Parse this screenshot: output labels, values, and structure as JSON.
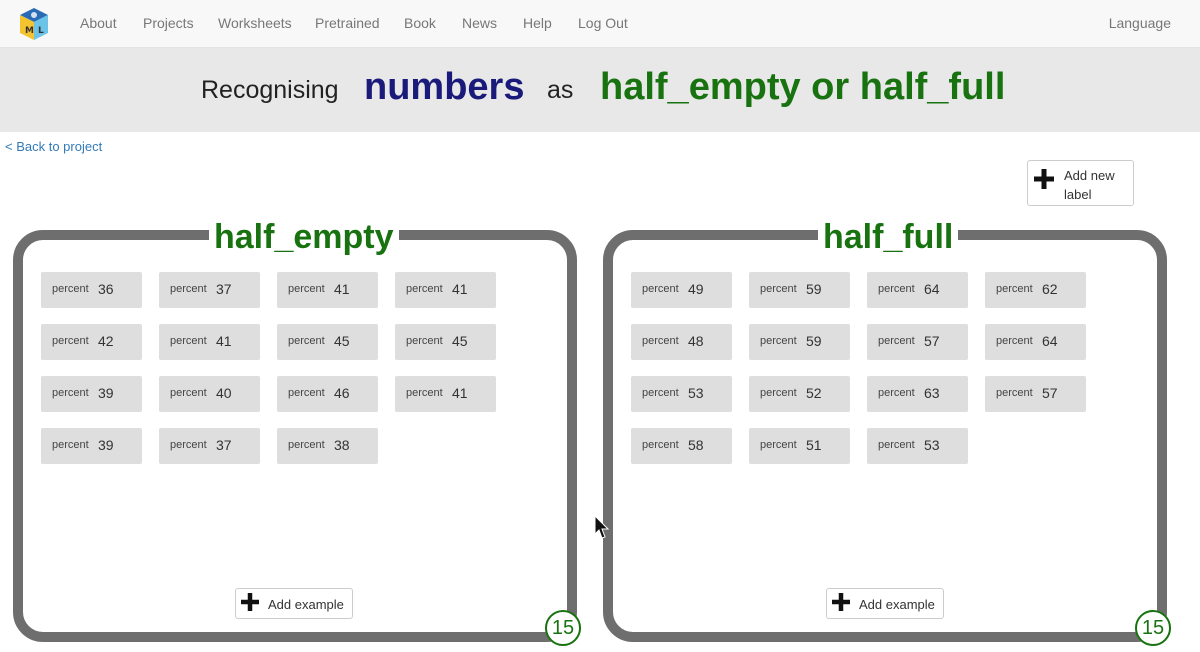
{
  "nav": {
    "items": [
      "About",
      "Projects",
      "Worksheets",
      "Pretrained",
      "Book",
      "News",
      "Help",
      "Log Out"
    ],
    "language": "Language"
  },
  "header": {
    "word_recognising": "Recognising",
    "project_name": "numbers",
    "word_as": "as",
    "labels_text": "half_empty or half_full"
  },
  "back_link": "< Back to project",
  "add_label_button": {
    "line1": "Add new",
    "line2": "label"
  },
  "buckets": [
    {
      "label": "half_empty",
      "examples": [
        {
          "key": "percent",
          "value": "36"
        },
        {
          "key": "percent",
          "value": "37"
        },
        {
          "key": "percent",
          "value": "41"
        },
        {
          "key": "percent",
          "value": "41"
        },
        {
          "key": "percent",
          "value": "42"
        },
        {
          "key": "percent",
          "value": "41"
        },
        {
          "key": "percent",
          "value": "45"
        },
        {
          "key": "percent",
          "value": "45"
        },
        {
          "key": "percent",
          "value": "39"
        },
        {
          "key": "percent",
          "value": "40"
        },
        {
          "key": "percent",
          "value": "46"
        },
        {
          "key": "percent",
          "value": "41"
        },
        {
          "key": "percent",
          "value": "39"
        },
        {
          "key": "percent",
          "value": "37"
        },
        {
          "key": "percent",
          "value": "38"
        }
      ],
      "add_example_label": "Add example",
      "count": "15"
    },
    {
      "label": "half_full",
      "examples": [
        {
          "key": "percent",
          "value": "49"
        },
        {
          "key": "percent",
          "value": "59"
        },
        {
          "key": "percent",
          "value": "64"
        },
        {
          "key": "percent",
          "value": "62"
        },
        {
          "key": "percent",
          "value": "48"
        },
        {
          "key": "percent",
          "value": "59"
        },
        {
          "key": "percent",
          "value": "57"
        },
        {
          "key": "percent",
          "value": "64"
        },
        {
          "key": "percent",
          "value": "53"
        },
        {
          "key": "percent",
          "value": "52"
        },
        {
          "key": "percent",
          "value": "63"
        },
        {
          "key": "percent",
          "value": "57"
        },
        {
          "key": "percent",
          "value": "58"
        },
        {
          "key": "percent",
          "value": "51"
        },
        {
          "key": "percent",
          "value": "53"
        }
      ],
      "add_example_label": "Add example",
      "count": "15"
    }
  ],
  "colors": {
    "project_name": "#1a1a7a",
    "label_green": "#17720f",
    "box_border": "#6e6e6e",
    "example_bg": "#dedede",
    "link": "#337ab7"
  },
  "icons": [
    "ml-logo-icon",
    "plus-icon",
    "mouse-cursor-icon"
  ]
}
